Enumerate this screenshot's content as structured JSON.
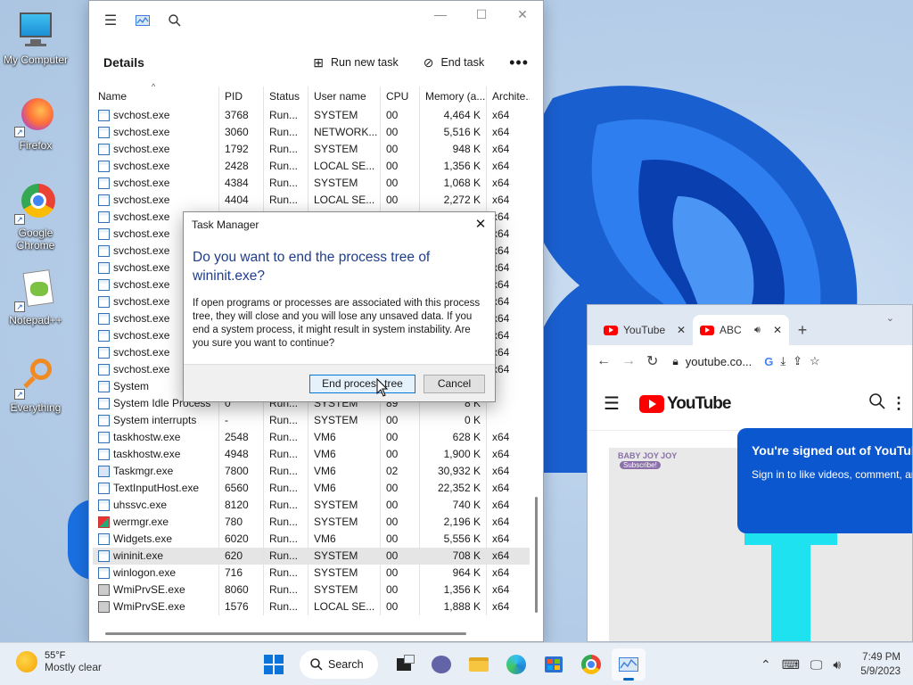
{
  "desktop": {
    "icons": [
      {
        "label": "My Computer"
      },
      {
        "label": "Firefox"
      },
      {
        "label": "Google Chrome"
      },
      {
        "label": "Notepad++"
      },
      {
        "label": "Everything"
      }
    ]
  },
  "task_manager": {
    "page_title": "Details",
    "run_new_task": "Run new task",
    "end_task": "End task",
    "columns": [
      "Name",
      "PID",
      "Status",
      "User name",
      "CPU",
      "Memory (a...",
      "Archite..."
    ],
    "rows": [
      {
        "name": "svchost.exe",
        "pid": "3768",
        "status": "Run...",
        "user": "SYSTEM",
        "cpu": "00",
        "mem": "4,464 K",
        "arch": "x64"
      },
      {
        "name": "svchost.exe",
        "pid": "3060",
        "status": "Run...",
        "user": "NETWORK...",
        "cpu": "00",
        "mem": "5,516 K",
        "arch": "x64"
      },
      {
        "name": "svchost.exe",
        "pid": "1792",
        "status": "Run...",
        "user": "SYSTEM",
        "cpu": "00",
        "mem": "948 K",
        "arch": "x64"
      },
      {
        "name": "svchost.exe",
        "pid": "2428",
        "status": "Run...",
        "user": "LOCAL SE...",
        "cpu": "00",
        "mem": "1,356 K",
        "arch": "x64"
      },
      {
        "name": "svchost.exe",
        "pid": "4384",
        "status": "Run...",
        "user": "SYSTEM",
        "cpu": "00",
        "mem": "1,068 K",
        "arch": "x64"
      },
      {
        "name": "svchost.exe",
        "pid": "4404",
        "status": "Run...",
        "user": "LOCAL SE...",
        "cpu": "00",
        "mem": "2,272 K",
        "arch": "x64"
      },
      {
        "name": "svchost.exe",
        "pid": "",
        "status": "",
        "user": "",
        "cpu": "",
        "mem": "",
        "arch": "x64"
      },
      {
        "name": "svchost.exe",
        "pid": "",
        "status": "",
        "user": "",
        "cpu": "",
        "mem": "",
        "arch": "x64"
      },
      {
        "name": "svchost.exe",
        "pid": "",
        "status": "",
        "user": "",
        "cpu": "",
        "mem": "",
        "arch": "x64"
      },
      {
        "name": "svchost.exe",
        "pid": "",
        "status": "",
        "user": "",
        "cpu": "",
        "mem": "",
        "arch": "x64"
      },
      {
        "name": "svchost.exe",
        "pid": "",
        "status": "",
        "user": "",
        "cpu": "",
        "mem": "",
        "arch": "x64"
      },
      {
        "name": "svchost.exe",
        "pid": "",
        "status": "",
        "user": "",
        "cpu": "",
        "mem": "",
        "arch": "x64"
      },
      {
        "name": "svchost.exe",
        "pid": "",
        "status": "",
        "user": "",
        "cpu": "",
        "mem": "",
        "arch": "x64"
      },
      {
        "name": "svchost.exe",
        "pid": "",
        "status": "",
        "user": "",
        "cpu": "",
        "mem": "",
        "arch": "x64"
      },
      {
        "name": "svchost.exe",
        "pid": "",
        "status": "",
        "user": "",
        "cpu": "",
        "mem": "",
        "arch": "x64"
      },
      {
        "name": "svchost.exe",
        "pid": "",
        "status": "",
        "user": "",
        "cpu": "",
        "mem": "",
        "arch": "x64"
      },
      {
        "name": "System",
        "pid": "",
        "status": "",
        "user": "",
        "cpu": "",
        "mem": "",
        "arch": ""
      },
      {
        "name": "System Idle Process",
        "pid": "0",
        "status": "Run...",
        "user": "SYSTEM",
        "cpu": "89",
        "mem": "8 K",
        "arch": ""
      },
      {
        "name": "System interrupts",
        "pid": "-",
        "status": "Run...",
        "user": "SYSTEM",
        "cpu": "00",
        "mem": "0 K",
        "arch": ""
      },
      {
        "name": "taskhostw.exe",
        "pid": "2548",
        "status": "Run...",
        "user": "VM6",
        "cpu": "00",
        "mem": "628 K",
        "arch": "x64"
      },
      {
        "name": "taskhostw.exe",
        "pid": "4948",
        "status": "Run...",
        "user": "VM6",
        "cpu": "00",
        "mem": "1,900 K",
        "arch": "x64"
      },
      {
        "name": "Taskmgr.exe",
        "pid": "7800",
        "status": "Run...",
        "user": "VM6",
        "cpu": "02",
        "mem": "30,932 K",
        "arch": "x64"
      },
      {
        "name": "TextInputHost.exe",
        "pid": "6560",
        "status": "Run...",
        "user": "VM6",
        "cpu": "00",
        "mem": "22,352 K",
        "arch": "x64"
      },
      {
        "name": "uhssvc.exe",
        "pid": "8120",
        "status": "Run...",
        "user": "SYSTEM",
        "cpu": "00",
        "mem": "740 K",
        "arch": "x64"
      },
      {
        "name": "wermgr.exe",
        "pid": "780",
        "status": "Run...",
        "user": "SYSTEM",
        "cpu": "00",
        "mem": "2,196 K",
        "arch": "x64"
      },
      {
        "name": "Widgets.exe",
        "pid": "6020",
        "status": "Run...",
        "user": "VM6",
        "cpu": "00",
        "mem": "5,556 K",
        "arch": "x64"
      },
      {
        "name": "wininit.exe",
        "pid": "620",
        "status": "Run...",
        "user": "SYSTEM",
        "cpu": "00",
        "mem": "708 K",
        "arch": "x64"
      },
      {
        "name": "winlogon.exe",
        "pid": "716",
        "status": "Run...",
        "user": "SYSTEM",
        "cpu": "00",
        "mem": "964 K",
        "arch": "x64"
      },
      {
        "name": "WmiPrvSE.exe",
        "pid": "8060",
        "status": "Run...",
        "user": "SYSTEM",
        "cpu": "00",
        "mem": "1,356 K",
        "arch": "x64"
      },
      {
        "name": "WmiPrvSE.exe",
        "pid": "1576",
        "status": "Run...",
        "user": "LOCAL SE...",
        "cpu": "00",
        "mem": "1,888 K",
        "arch": "x64"
      }
    ],
    "selected_name": "wininit.exe"
  },
  "dialog": {
    "title": "Task Manager",
    "question": "Do you want to end the process tree of wininit.exe?",
    "body": "If open programs or processes are associated with this process tree, they will close and you will lose any unsaved data. If you end a system process, it might result in system instability. Are you sure you want to continue?",
    "primary_button": "End process tree",
    "cancel_button": "Cancel"
  },
  "chrome": {
    "tabs": [
      {
        "label": "YouTube"
      },
      {
        "label": "ABC"
      }
    ],
    "url": "youtube.co...",
    "yt_brand": "YouTube",
    "thumb_text": "BABY JOY JOY",
    "thumb_badge": "Subscribe!",
    "signed_out_title": "You're signed out of YouTub",
    "signed_out_sub": "Sign in to like videos, comment, ar"
  },
  "taskbar": {
    "temp": "55°F",
    "weather": "Mostly clear",
    "search_label": "Search",
    "time": "7:49 PM",
    "date": "5/9/2023"
  },
  "colors": {
    "accent": "#0067c0",
    "dialog_question": "#1f3d8a",
    "youtube_red": "#ff0000",
    "signin_card": "#0b57d0"
  }
}
